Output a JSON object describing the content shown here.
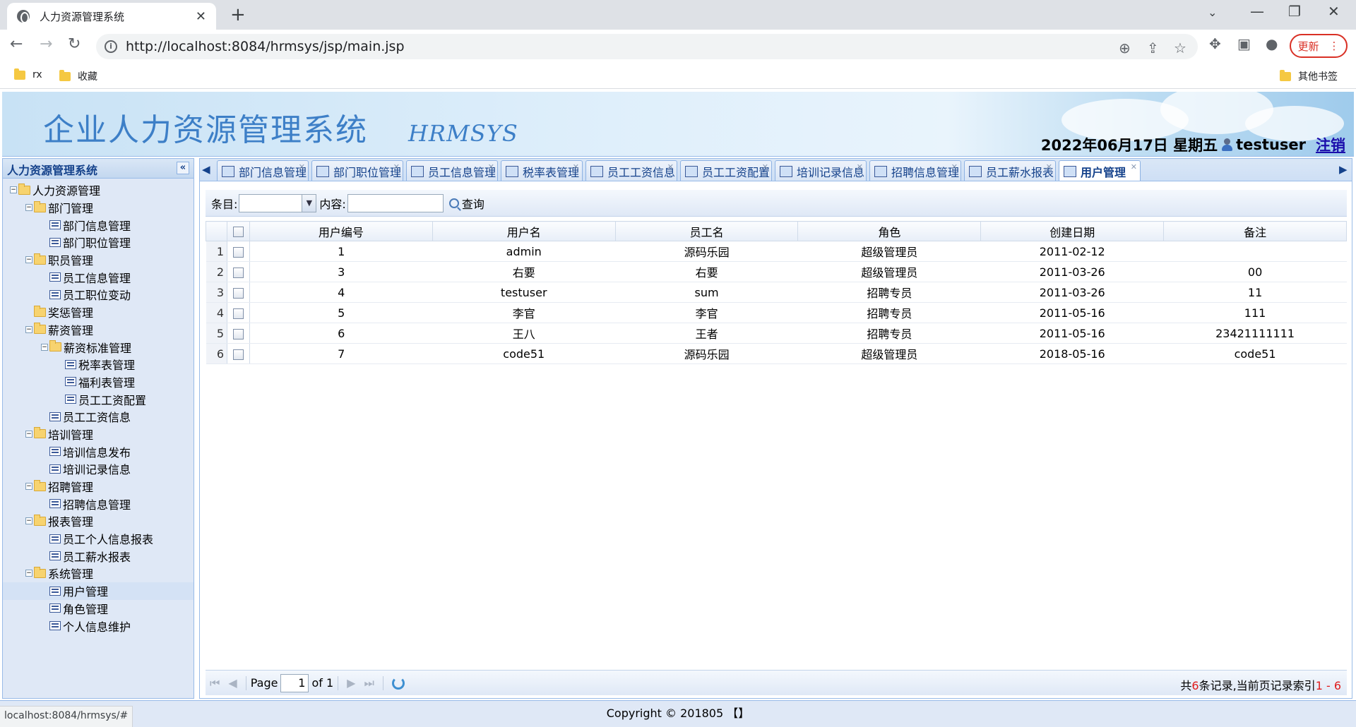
{
  "browser": {
    "tab_title": "人力资源管理系统",
    "url": "http://localhost:8084/hrmsys/jsp/main.jsp",
    "update_label": "更新",
    "bookmarks": [
      "rx",
      "收藏"
    ],
    "other_bookmarks": "其他书签",
    "status_url": "localhost:8084/hrmsys/#"
  },
  "header": {
    "title": "企业人力资源管理系统",
    "subtitle": "HRMSYS",
    "date": "2022年06月17日 星期五",
    "user": "testuser",
    "logout": "注销"
  },
  "west": {
    "title": "人力资源管理系统",
    "tree": [
      {
        "label": "人力资源管理",
        "level": 0,
        "type": "folder"
      },
      {
        "label": "部门管理",
        "level": 1,
        "type": "folder"
      },
      {
        "label": "部门信息管理",
        "level": 2,
        "type": "leaf"
      },
      {
        "label": "部门职位管理",
        "level": 2,
        "type": "leaf"
      },
      {
        "label": "职员管理",
        "level": 1,
        "type": "folder"
      },
      {
        "label": "员工信息管理",
        "level": 2,
        "type": "leaf"
      },
      {
        "label": "员工职位变动",
        "level": 2,
        "type": "leaf"
      },
      {
        "label": "奖惩管理",
        "level": 1,
        "type": "folder-leaf"
      },
      {
        "label": "薪资管理",
        "level": 1,
        "type": "folder"
      },
      {
        "label": "薪资标准管理",
        "level": 2,
        "type": "folder"
      },
      {
        "label": "税率表管理",
        "level": 3,
        "type": "leaf"
      },
      {
        "label": "福利表管理",
        "level": 3,
        "type": "leaf"
      },
      {
        "label": "员工工资配置",
        "level": 3,
        "type": "leaf"
      },
      {
        "label": "员工工资信息",
        "level": 2,
        "type": "leaf"
      },
      {
        "label": "培训管理",
        "level": 1,
        "type": "folder"
      },
      {
        "label": "培训信息发布",
        "level": 2,
        "type": "leaf"
      },
      {
        "label": "培训记录信息",
        "level": 2,
        "type": "leaf"
      },
      {
        "label": "招聘管理",
        "level": 1,
        "type": "folder"
      },
      {
        "label": "招聘信息管理",
        "level": 2,
        "type": "leaf"
      },
      {
        "label": "报表管理",
        "level": 1,
        "type": "folder"
      },
      {
        "label": "员工个人信息报表",
        "level": 2,
        "type": "leaf"
      },
      {
        "label": "员工薪水报表",
        "level": 2,
        "type": "leaf"
      },
      {
        "label": "系统管理",
        "level": 1,
        "type": "folder"
      },
      {
        "label": "用户管理",
        "level": 2,
        "type": "leaf",
        "selected": true
      },
      {
        "label": "角色管理",
        "level": 2,
        "type": "leaf"
      },
      {
        "label": "个人信息维护",
        "level": 2,
        "type": "leaf"
      }
    ]
  },
  "tabs": [
    {
      "label": "部门信息管理"
    },
    {
      "label": "部门职位管理"
    },
    {
      "label": "员工信息管理"
    },
    {
      "label": "税率表管理"
    },
    {
      "label": "员工工资信息"
    },
    {
      "label": "员工工资配置"
    },
    {
      "label": "培训记录信息"
    },
    {
      "label": "招聘信息管理"
    },
    {
      "label": "员工薪水报表"
    },
    {
      "label": "用户管理",
      "active": true
    }
  ],
  "filter": {
    "field_label": "条目:",
    "content_label": "内容:",
    "query_label": "查询"
  },
  "grid": {
    "columns": [
      "用户编号",
      "用户名",
      "员工名",
      "角色",
      "创建日期",
      "备注"
    ],
    "rows": [
      [
        "1",
        "admin",
        "源码乐园",
        "超级管理员",
        "2011-02-12",
        ""
      ],
      [
        "3",
        "右要",
        "右要",
        "超级管理员",
        "2011-03-26",
        "00"
      ],
      [
        "4",
        "testuser",
        "sum",
        "招聘专员",
        "2011-03-26",
        "11"
      ],
      [
        "5",
        "李官",
        "李官",
        "招聘专员",
        "2011-05-16",
        "111"
      ],
      [
        "6",
        "王八",
        "王者",
        "招聘专员",
        "2011-05-16",
        "23421111111"
      ],
      [
        "7",
        "code51",
        "源码乐园",
        "超级管理员",
        "2018-05-16",
        "code51"
      ]
    ]
  },
  "pager": {
    "page_label": "Page",
    "page_value": "1",
    "of_label": "of 1",
    "info_prefix": "共",
    "total": "6",
    "info_mid": "条记录,当前页记录索引",
    "range": "1 - 6"
  },
  "footer": {
    "copyright": "Copyright © 201805 【】"
  }
}
